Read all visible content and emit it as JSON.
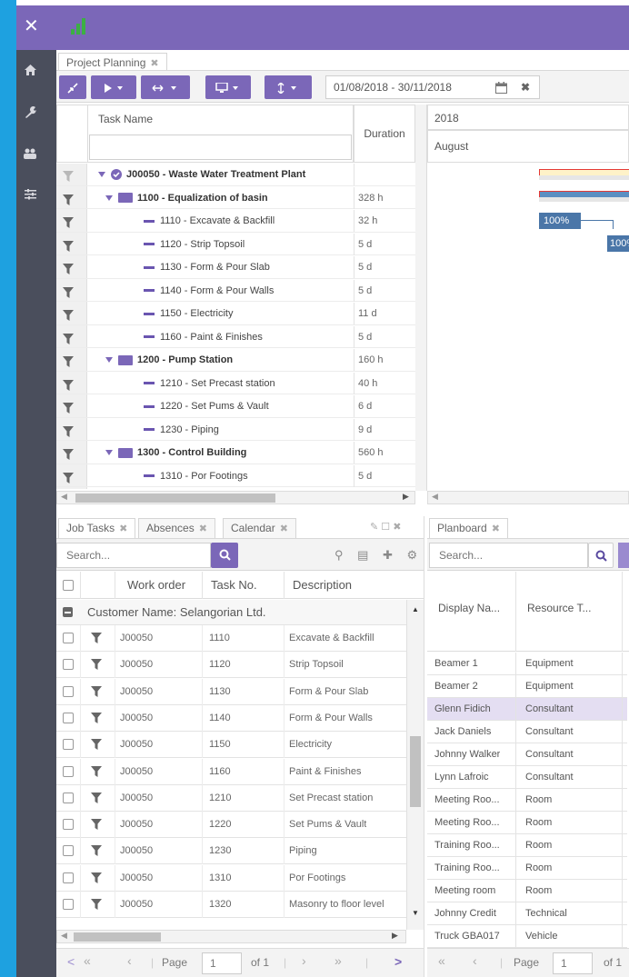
{
  "app": {
    "close_icon": "✕"
  },
  "tabs": {
    "project_planning": "Project Planning"
  },
  "toolbar": {
    "date_range": "01/08/2018 - 30/11/2018"
  },
  "gantt": {
    "col_task": "Task Name",
    "col_duration": "Duration",
    "year": "2018",
    "month": "August",
    "bar1_label": "100%",
    "bar2_label": "100%"
  },
  "tasks": [
    {
      "name": "J00050 - Waste Water Treatment Plant",
      "duration": "",
      "level": 0,
      "type": "project"
    },
    {
      "name": "1100 - Equalization of basin",
      "duration": "328 h",
      "level": 1,
      "type": "group"
    },
    {
      "name": "1110 - Excavate & Backfill",
      "duration": "32 h",
      "level": 2,
      "type": "task"
    },
    {
      "name": "1120 - Strip Topsoil",
      "duration": "5 d",
      "level": 2,
      "type": "task"
    },
    {
      "name": "1130 - Form & Pour Slab",
      "duration": "5 d",
      "level": 2,
      "type": "task"
    },
    {
      "name": "1140 - Form & Pour Walls",
      "duration": "5 d",
      "level": 2,
      "type": "task"
    },
    {
      "name": "1150 - Electricity",
      "duration": "11 d",
      "level": 2,
      "type": "task"
    },
    {
      "name": "1160 - Paint & Finishes",
      "duration": "5 d",
      "level": 2,
      "type": "task"
    },
    {
      "name": "1200 - Pump Station",
      "duration": "160 h",
      "level": 1,
      "type": "group"
    },
    {
      "name": "1210 - Set Precast station",
      "duration": "40 h",
      "level": 2,
      "type": "task"
    },
    {
      "name": "1220 - Set Pums & Vault",
      "duration": "6 d",
      "level": 2,
      "type": "task"
    },
    {
      "name": "1230 - Piping",
      "duration": "9 d",
      "level": 2,
      "type": "task"
    },
    {
      "name": "1300 - Control Building",
      "duration": "560 h",
      "level": 1,
      "type": "group"
    },
    {
      "name": "1310 - Por Footings",
      "duration": "5 d",
      "level": 2,
      "type": "task"
    }
  ],
  "bottom_tabs": {
    "job_tasks": "Job Tasks",
    "absences": "Absences",
    "calendar": "Calendar",
    "planboard": "Planboard"
  },
  "job_tasks": {
    "search_placeholder": "Search...",
    "col_work_order": "Work order",
    "col_task_no": "Task No.",
    "col_description": "Description",
    "group_label": "Customer Name: Selangorian Ltd.",
    "rows": [
      {
        "wo": "J00050",
        "no": "1110",
        "desc": "Excavate & Backfill"
      },
      {
        "wo": "J00050",
        "no": "1120",
        "desc": "Strip Topsoil"
      },
      {
        "wo": "J00050",
        "no": "1130",
        "desc": "Form & Pour Slab"
      },
      {
        "wo": "J00050",
        "no": "1140",
        "desc": "Form & Pour Walls"
      },
      {
        "wo": "J00050",
        "no": "1150",
        "desc": "Electricity"
      },
      {
        "wo": "J00050",
        "no": "1160",
        "desc": "Paint & Finishes"
      },
      {
        "wo": "J00050",
        "no": "1210",
        "desc": "Set Precast station"
      },
      {
        "wo": "J00050",
        "no": "1220",
        "desc": "Set Pums & Vault"
      },
      {
        "wo": "J00050",
        "no": "1230",
        "desc": "Piping"
      },
      {
        "wo": "J00050",
        "no": "1310",
        "desc": "Por Footings"
      },
      {
        "wo": "J00050",
        "no": "1320",
        "desc": "Masonry to floor level"
      }
    ],
    "pager": {
      "page_label": "Page",
      "page_value": "1",
      "of_label": "of 1"
    }
  },
  "planboard": {
    "search_placeholder": "Search...",
    "col_display": "Display Na...",
    "col_resource": "Resource T...",
    "rows": [
      {
        "name": "Beamer 1",
        "type": "Equipment"
      },
      {
        "name": "Beamer 2",
        "type": "Equipment"
      },
      {
        "name": "Glenn Fidich",
        "type": "Consultant"
      },
      {
        "name": "Jack Daniels",
        "type": "Consultant"
      },
      {
        "name": "Johnny Walker",
        "type": "Consultant"
      },
      {
        "name": "Lynn Lafroic",
        "type": "Consultant"
      },
      {
        "name": "Meeting Roo...",
        "type": "Room"
      },
      {
        "name": "Meeting Roo...",
        "type": "Room"
      },
      {
        "name": "Training Roo...",
        "type": "Room"
      },
      {
        "name": "Training Roo...",
        "type": "Room"
      },
      {
        "name": "Meeting room",
        "type": "Room"
      },
      {
        "name": "Johnny Credit",
        "type": "Technical"
      },
      {
        "name": "Truck GBA017",
        "type": "Vehicle"
      }
    ],
    "pager": {
      "page_label": "Page",
      "page_value": "1",
      "of_label": "of 1"
    }
  },
  "colors": {
    "accent": "#7b67b8",
    "edge": "#1ea1e0",
    "sidebar": "#4a4e5c",
    "selected_row": "#e4def2"
  }
}
